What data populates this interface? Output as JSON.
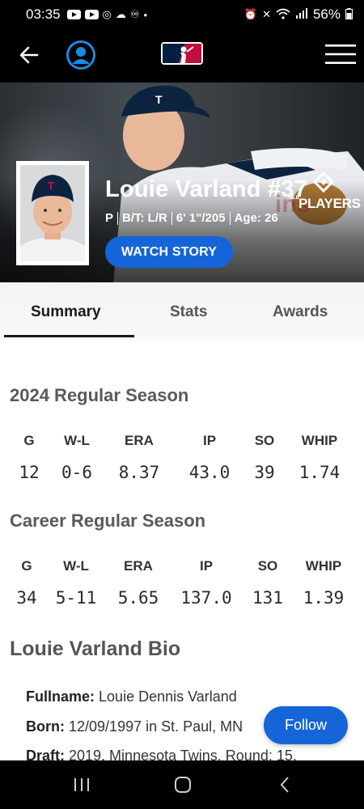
{
  "status_bar": {
    "time": "03:35",
    "battery": "56%"
  },
  "header": {
    "back_icon": "arrow-left-icon",
    "profile_icon": "user-circle-icon",
    "logo_icon": "mlb-logo",
    "menu_icon": "hamburger-menu-icon"
  },
  "hero": {
    "players_logo_text": "PLAYERS",
    "players_logo_small": "MLB",
    "name": "Louie Varland #37",
    "position": "P",
    "bats_throws": "B/T: L/R",
    "height_weight": "6' 1\"/205",
    "age": "Age: 26",
    "watch_story_label": "WATCH STORY"
  },
  "tabs": [
    {
      "label": "Summary",
      "active": true
    },
    {
      "label": "Stats",
      "active": false
    },
    {
      "label": "Awards",
      "active": false
    }
  ],
  "season_2024": {
    "title": "2024 Regular Season",
    "headers": [
      "G",
      "W-L",
      "ERA",
      "IP",
      "SO",
      "WHIP"
    ],
    "values": [
      "12",
      "0-6",
      "8.37",
      "43.0",
      "39",
      "1.74"
    ]
  },
  "career": {
    "title": "Career Regular Season",
    "headers": [
      "G",
      "W-L",
      "ERA",
      "IP",
      "SO",
      "WHIP"
    ],
    "values": [
      "34",
      "5-11",
      "5.65",
      "137.0",
      "131",
      "1.39"
    ]
  },
  "bio": {
    "title": "Louie Varland Bio",
    "fullname_label": "Fullname:",
    "fullname_value": "Louie Dennis Varland",
    "born_label": "Born:",
    "born_value": "12/09/1997 in St. Paul, MN",
    "draft_label": "Draft:",
    "draft_value": "2019, Minnesota Twins, Round: 15,"
  },
  "follow_label": "Follow",
  "colors": {
    "accent_blue": "#1565d8",
    "twins_navy": "#0c2340",
    "twins_red": "#d31145"
  }
}
